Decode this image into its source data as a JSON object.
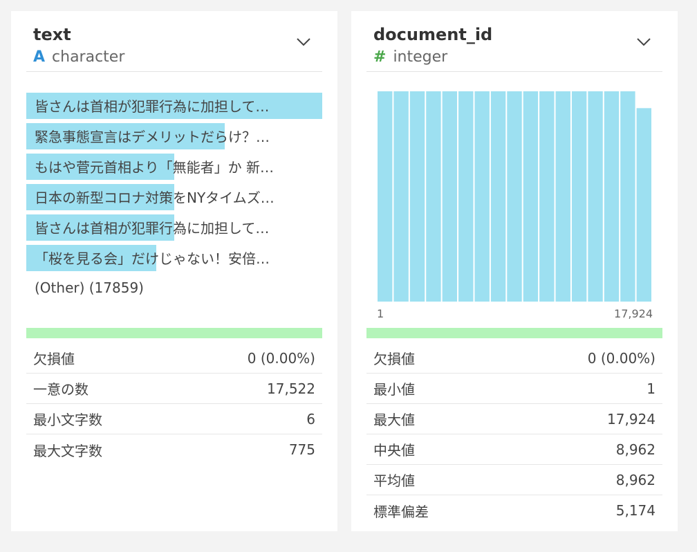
{
  "text_column": {
    "name": "text",
    "type_icon": "A",
    "type": "character",
    "categories": [
      {
        "label": "皆さんは首相が犯罪行為に加担して…",
        "fraction": 1.0
      },
      {
        "label": "緊急事態宣言はデメリットだらけ？…",
        "fraction": 0.67
      },
      {
        "label": "もはや菅元首相より「無能者」か 新…",
        "fraction": 0.5
      },
      {
        "label": "日本の新型コロナ対策をNYタイムズ…",
        "fraction": 0.5
      },
      {
        "label": "皆さんは首相が犯罪行為に加担して…",
        "fraction": 0.5
      },
      {
        "label": "「桜を見る会」だけじゃない！安倍…",
        "fraction": 0.44
      }
    ],
    "other_label": "(Other) (17859)",
    "stats": [
      {
        "label": "欠損値",
        "value": "0 (0.00%)"
      },
      {
        "label": "一意の数",
        "value": "17,522"
      },
      {
        "label": "最小文字数",
        "value": "6"
      },
      {
        "label": "最大文字数",
        "value": "775"
      }
    ]
  },
  "docid_column": {
    "name": "document_id",
    "type_icon": "#",
    "type": "integer",
    "axis_min": "1",
    "axis_max": "17,924",
    "stats": [
      {
        "label": "欠損値",
        "value": "0 (0.00%)"
      },
      {
        "label": "最小値",
        "value": "1"
      },
      {
        "label": "最大値",
        "value": "17,924"
      },
      {
        "label": "中央値",
        "value": "8,962"
      },
      {
        "label": "平均値",
        "value": "8,962"
      },
      {
        "label": "標準偏差",
        "value": "5,174"
      }
    ]
  },
  "chart_data": {
    "type": "bar",
    "x_range": [
      1,
      17924
    ],
    "bin_count": 17,
    "values": [
      1,
      1,
      1,
      1,
      1,
      1,
      1,
      1,
      1,
      1,
      1,
      1,
      1,
      1,
      1,
      1,
      0.92
    ],
    "ylim": [
      0,
      1
    ],
    "grid": false
  },
  "colors": {
    "bar": "#9de0f1",
    "quality_bar": "#b4f4b9",
    "char_icon": "#2f8fd6",
    "num_icon": "#4aa74a"
  }
}
